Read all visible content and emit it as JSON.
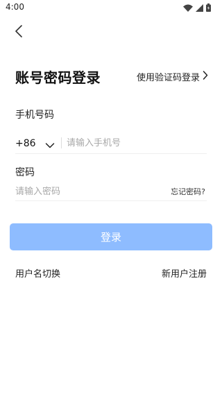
{
  "status_bar": {
    "time": "4:00",
    "icons": [
      "wifi-icon",
      "signal-icon",
      "battery-icon"
    ]
  },
  "nav": {
    "back_icon": "chevron-left-icon"
  },
  "header": {
    "title": "账号密码登录",
    "switch_label": "使用验证码登录",
    "switch_icon": "chevron-right-icon"
  },
  "phone": {
    "label": "手机号码",
    "country_code": "+86",
    "country_icon": "chevron-down-icon",
    "placeholder": "请输入手机号",
    "value": ""
  },
  "password": {
    "label": "密码",
    "placeholder": "请输入密码",
    "value": "",
    "forgot_label": "忘记密码?"
  },
  "actions": {
    "login_label": "登录",
    "username_switch_label": "用户名切换",
    "new_user_label": "新用户注册"
  },
  "colors": {
    "login_button_bg": "#8ebcff",
    "login_button_text": "#ffffff",
    "divider": "#efefef",
    "placeholder": "#a8a8a8"
  }
}
